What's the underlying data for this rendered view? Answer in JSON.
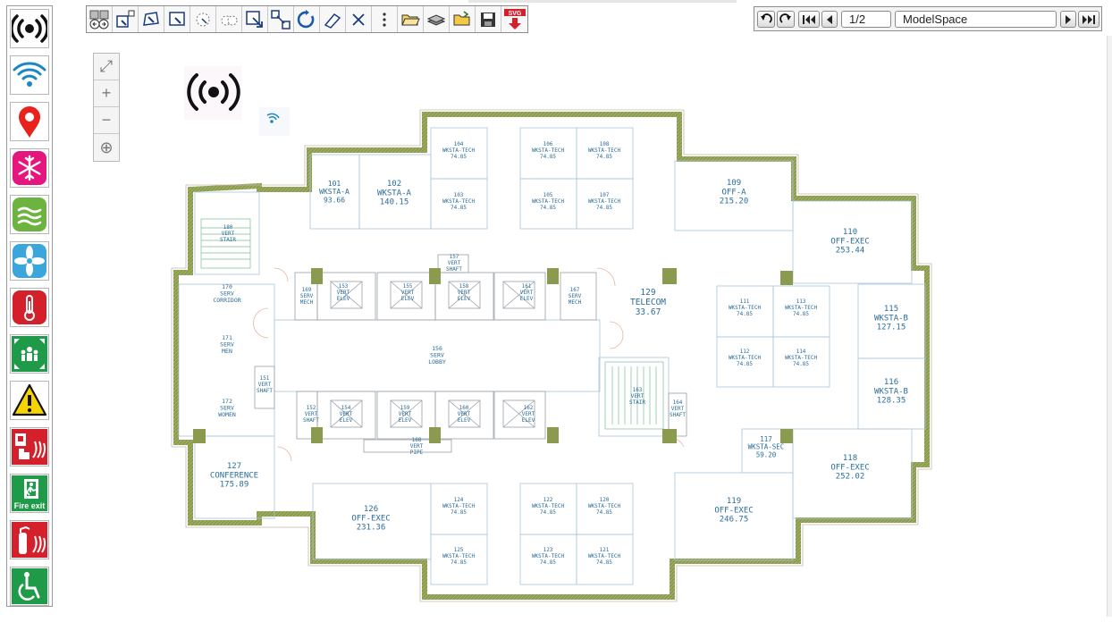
{
  "palette": {
    "items": [
      {
        "name": "wireless-signal-icon",
        "color": "#111111"
      },
      {
        "name": "wifi-icon",
        "color": "#1b88c4"
      },
      {
        "name": "location-pin-icon",
        "color": "#e8231b"
      },
      {
        "name": "snowflake-icon",
        "color": "#e6167f"
      },
      {
        "name": "air-flow-icon",
        "color": "#6cb33f"
      },
      {
        "name": "fan-icon",
        "color": "#3aa6dc"
      },
      {
        "name": "thermometer-icon",
        "color": "#d4202a"
      },
      {
        "name": "assembly-point-icon",
        "color": "#1f9a48"
      },
      {
        "name": "warning-icon",
        "color": "#f5d400"
      },
      {
        "name": "fire-alarm-icon",
        "color": "#d4202a"
      },
      {
        "name": "fire-exit-icon",
        "color": "#1f9a48",
        "label": "Fire exit"
      },
      {
        "name": "fire-extinguisher-icon",
        "color": "#d4202a"
      },
      {
        "name": "accessible-icon",
        "color": "#1f9a48"
      }
    ]
  },
  "toolbar": {
    "buttons": [
      "undo-redo-view-icon",
      "zoom-window-icon",
      "zoom-polygon-icon",
      "select-window-icon",
      "select-circle-icon",
      "measure-icon",
      "zoom-extents-icon",
      "move-icon",
      "rotate-icon",
      "erase-icon",
      "delete-icon",
      "more-icon",
      "open-folder-icon",
      "layers-icon",
      "open-file-icon",
      "save-icon",
      "export-svg-icon"
    ],
    "svg_badge": "SVG"
  },
  "nav": {
    "page": "1/2",
    "layout": "ModelSpace"
  },
  "zoom": {
    "fit": "⤢",
    "in": "+",
    "out": "−",
    "search": "⊕"
  },
  "rooms": [
    {
      "id": "101",
      "lines": [
        "101",
        "WKSTA-A",
        "93.66"
      ]
    },
    {
      "id": "102",
      "lines": [
        "102",
        "WKSTA-A",
        "140.15"
      ]
    },
    {
      "id": "104",
      "lines": [
        "104",
        "WKSTA-TECH",
        "74.85"
      ]
    },
    {
      "id": "103",
      "lines": [
        "103",
        "WKSTA-TECH",
        "74.85"
      ]
    },
    {
      "id": "106",
      "lines": [
        "106",
        "WKSTA-TECH",
        "74.85"
      ]
    },
    {
      "id": "108",
      "lines": [
        "108",
        "WKSTA-TECH",
        "74.85"
      ]
    },
    {
      "id": "105",
      "lines": [
        "105",
        "WKSTA-TECH",
        "74.85"
      ]
    },
    {
      "id": "107",
      "lines": [
        "107",
        "WKSTA-TECH",
        "74.85"
      ]
    },
    {
      "id": "109",
      "lines": [
        "109",
        "OFF-A",
        "215.20"
      ]
    },
    {
      "id": "110",
      "lines": [
        "110",
        "OFF-EXEC",
        "253.44"
      ]
    },
    {
      "id": "180",
      "lines": [
        "180",
        "VERT",
        "STAIR"
      ]
    },
    {
      "id": "157",
      "lines": [
        "157",
        "VERT",
        "SHAFT"
      ]
    },
    {
      "id": "170",
      "lines": [
        "170",
        "SERV",
        "CORRIDOR"
      ]
    },
    {
      "id": "169",
      "lines": [
        "169",
        "SERV",
        "MECH"
      ]
    },
    {
      "id": "153",
      "lines": [
        "153",
        "VERT",
        "ELEV"
      ]
    },
    {
      "id": "155",
      "lines": [
        "155",
        "VERT",
        "ELEV"
      ]
    },
    {
      "id": "158",
      "lines": [
        "158",
        "VERT",
        "ELEV"
      ]
    },
    {
      "id": "161",
      "lines": [
        "161",
        "VERT",
        "ELEV"
      ]
    },
    {
      "id": "167",
      "lines": [
        "167",
        "SERV",
        "MECH"
      ]
    },
    {
      "id": "129",
      "lines": [
        "129",
        "TELECOM",
        "33.67"
      ]
    },
    {
      "id": "111",
      "lines": [
        "111",
        "WKSTA-TECH",
        "74.85"
      ]
    },
    {
      "id": "113",
      "lines": [
        "113",
        "WKSTA-TECH",
        "74.85"
      ]
    },
    {
      "id": "112",
      "lines": [
        "112",
        "WKSTA-TECH",
        "74.85"
      ]
    },
    {
      "id": "114",
      "lines": [
        "114",
        "WKSTA-TECH",
        "74.85"
      ]
    },
    {
      "id": "115",
      "lines": [
        "115",
        "WKSTA-B",
        "127.15"
      ]
    },
    {
      "id": "116",
      "lines": [
        "116",
        "WKSTA-B",
        "128.35"
      ]
    },
    {
      "id": "171",
      "lines": [
        "171",
        "SERV",
        "MEN"
      ]
    },
    {
      "id": "156",
      "lines": [
        "156",
        "SERV",
        "LOBBY"
      ]
    },
    {
      "id": "151",
      "lines": [
        "151",
        "VERT",
        "SHAFT"
      ]
    },
    {
      "id": "172",
      "lines": [
        "172",
        "SERV",
        "WOMEN"
      ]
    },
    {
      "id": "152",
      "lines": [
        "152",
        "VERT",
        "SHAFT"
      ]
    },
    {
      "id": "154",
      "lines": [
        "154",
        "VERT",
        "ELEV"
      ]
    },
    {
      "id": "159",
      "lines": [
        "159",
        "VERT",
        "ELEV"
      ]
    },
    {
      "id": "160",
      "lines": [
        "160",
        "VERT",
        "ELEV"
      ]
    },
    {
      "id": "162",
      "lines": [
        "162",
        "VERT",
        "ELEV"
      ]
    },
    {
      "id": "163",
      "lines": [
        "163",
        "VERT",
        "STAIR"
      ]
    },
    {
      "id": "164",
      "lines": [
        "164",
        "VERT",
        "SHAFT"
      ]
    },
    {
      "id": "168",
      "lines": [
        "168",
        "VERT",
        "PIPE"
      ]
    },
    {
      "id": "117",
      "lines": [
        "117",
        "WKSTA-SEC",
        "59.20"
      ]
    },
    {
      "id": "118",
      "lines": [
        "118",
        "OFF-EXEC",
        "252.02"
      ]
    },
    {
      "id": "127",
      "lines": [
        "127",
        "CONFERENCE",
        "175.89"
      ]
    },
    {
      "id": "126",
      "lines": [
        "126",
        "OFF-EXEC",
        "231.36"
      ]
    },
    {
      "id": "124",
      "lines": [
        "124",
        "WKSTA-TECH",
        "74.85"
      ]
    },
    {
      "id": "125",
      "lines": [
        "125",
        "WKSTA-TECH",
        "74.85"
      ]
    },
    {
      "id": "122",
      "lines": [
        "122",
        "WKSTA-TECH",
        "74.85"
      ]
    },
    {
      "id": "120",
      "lines": [
        "120",
        "WKSTA-TECH",
        "74.85"
      ]
    },
    {
      "id": "123",
      "lines": [
        "123",
        "WKSTA-TECH",
        "74.85"
      ]
    },
    {
      "id": "121",
      "lines": [
        "121",
        "WKSTA-TECH",
        "74.85"
      ]
    },
    {
      "id": "119",
      "lines": [
        "119",
        "OFF-EXEC",
        "246.75"
      ]
    }
  ],
  "colors": {
    "wall": "#8a9a4e",
    "room_line": "#9fc0d6",
    "text": "#2a6c9a",
    "door": "#e7b59c"
  }
}
